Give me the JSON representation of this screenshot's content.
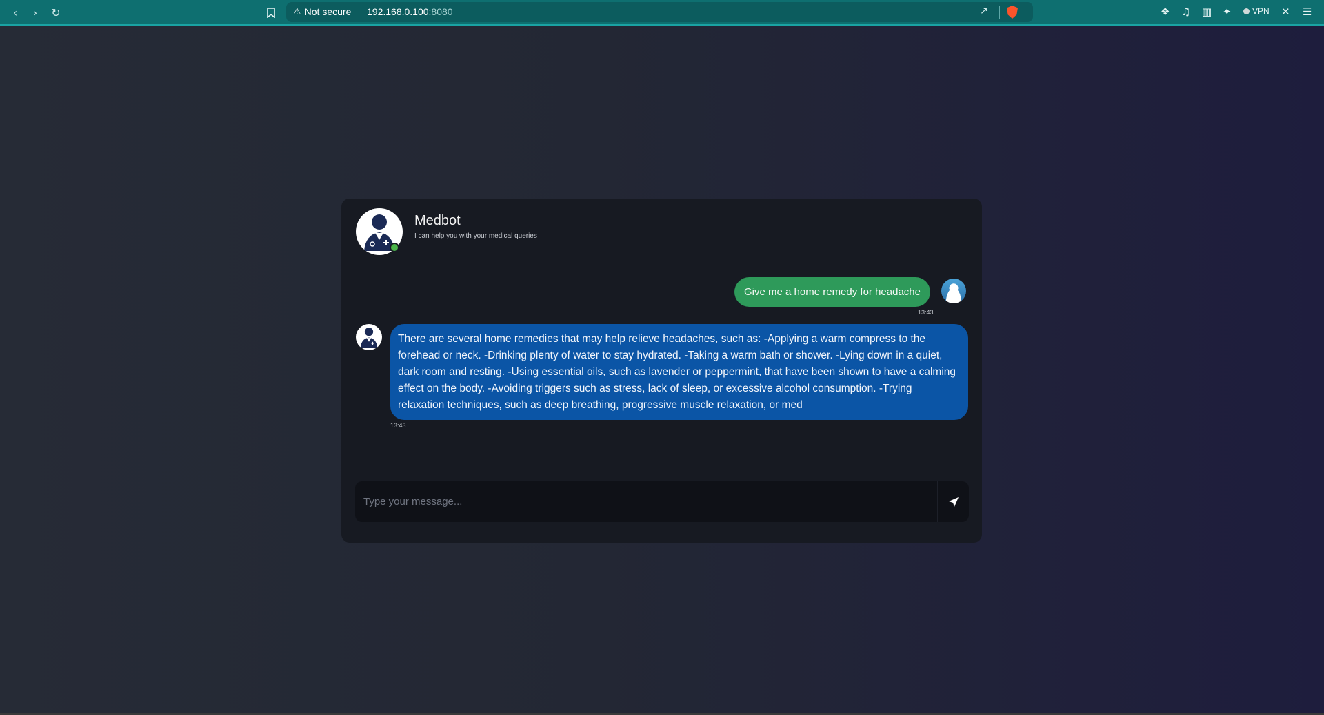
{
  "browser": {
    "security_label": "Not secure",
    "url_host": "192.168.0.100",
    "url_port": ":8080",
    "vpn_label": "VPN",
    "accent_color": "#0e6f70"
  },
  "chat": {
    "bot_name": "Medbot",
    "bot_tagline": "I can help you with your medical queries",
    "messages": [
      {
        "sender": "user",
        "text": "Give me a home remedy for headache",
        "time": "13:43"
      },
      {
        "sender": "bot",
        "text": "There are several home remedies that may help relieve headaches, such as: -Applying a warm compress to the forehead or neck. -Drinking plenty of water to stay hydrated. -Taking a warm bath or shower. -Lying down in a quiet, dark room and resting. -Using essential oils, such as lavender or peppermint, that have been shown to have a calming effect on the body. -Avoiding triggers such as stress, lack of sleep, or excessive alcohol consumption. -Trying relaxation techniques, such as deep breathing, progressive muscle relaxation, or med",
        "time": "13:43"
      }
    ],
    "input": {
      "placeholder": "Type your message...",
      "value": ""
    },
    "colors": {
      "user_bubble": "#2e9a5a",
      "bot_bubble": "#0b55a6",
      "online": "#4bb54a"
    }
  }
}
